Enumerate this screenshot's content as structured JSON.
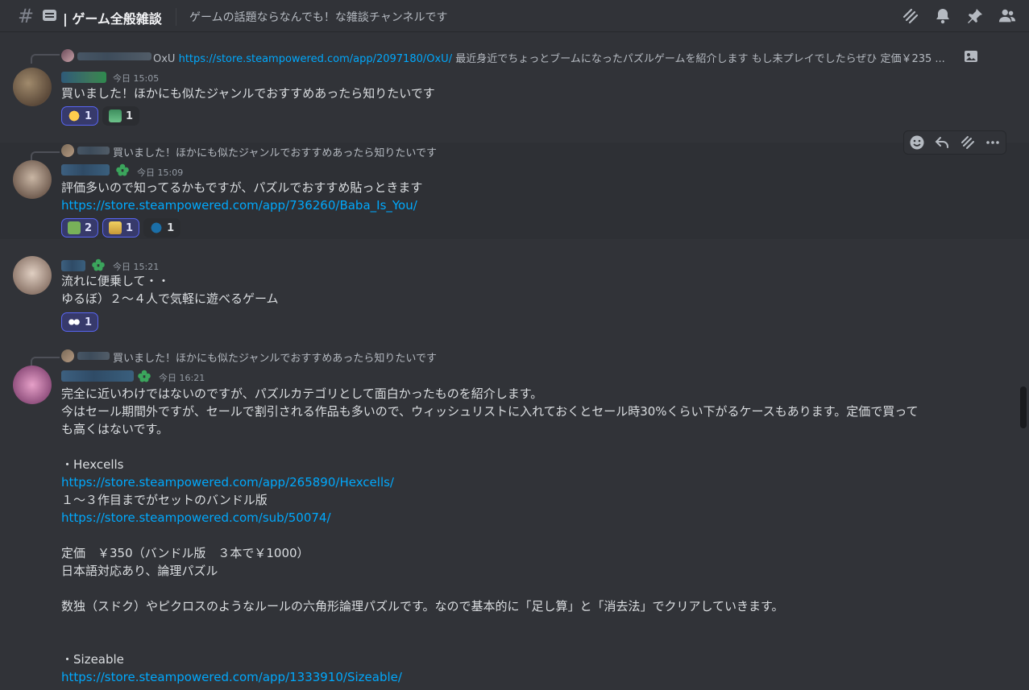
{
  "header": {
    "channel_name": "| ゲーム全般雑談",
    "topic": "ゲームの話題ならなんでも！な雑談チャンネルです"
  },
  "messages": [
    {
      "reply_preview": "OxU",
      "reply_link": "https://store.steampowered.com/app/2097180/OxU/",
      "reply_text": "最近身近でちょっとブームになったパズルゲームを紹介します もし未プレイでしたらぜひ 定価￥235 ...",
      "timestamp": "今日 15:05",
      "lines": [
        "買いました！ほかにも似たジャンルでおすすめあったら知りたいです"
      ],
      "reactions": [
        {
          "emoji": "star-struck-icon",
          "count": "1",
          "me": true
        },
        {
          "emoji": "money-icon",
          "count": "1",
          "me": false
        }
      ]
    },
    {
      "reply_text": "買いました！ほかにも似たジャンルでおすすめあったら知りたいです",
      "timestamp": "今日 15:09",
      "lines": [
        "評価多いので知ってるかもですが、パズルでおすすめ貼っときます"
      ],
      "link": "https://store.steampowered.com/app/736260/Baba_Is_You/",
      "reactions": [
        {
          "emoji": "puzzle-icon",
          "count": "2",
          "me": true
        },
        {
          "emoji": "pixel-face-icon",
          "count": "1",
          "me": true
        },
        {
          "emoji": "steam-icon",
          "count": "1",
          "me": false
        }
      ]
    },
    {
      "timestamp": "今日 15:21",
      "lines": [
        "流れに便乗して・・",
        "ゆるぼ）２～４人で気軽に遊べるゲーム"
      ],
      "reactions": [
        {
          "emoji": "eyes-icon",
          "count": "1",
          "me": true
        }
      ]
    },
    {
      "reply_text": "買いました！ほかにも似たジャンルでおすすめあったら知りたいです",
      "timestamp": "今日 16:21",
      "body": [
        {
          "t": "text",
          "v": "完全に近いわけではないのですが、パズルカテゴリとして面白かったものを紹介します。"
        },
        {
          "t": "text",
          "v": "今はセール期間外ですが、セールで割引される作品も多いので、ウィッシュリストに入れておくとセール時30%くらい下がるケースもあります。定価で買って"
        },
        {
          "t": "text",
          "v": "も高くはないです。"
        },
        {
          "t": "text",
          "v": ""
        },
        {
          "t": "text",
          "v": "・Hexcells"
        },
        {
          "t": "link",
          "v": "https://store.steampowered.com/app/265890/Hexcells/"
        },
        {
          "t": "text",
          "v": "１～３作目までがセットのバンドル版"
        },
        {
          "t": "link",
          "v": "https://store.steampowered.com/sub/50074/"
        },
        {
          "t": "text",
          "v": ""
        },
        {
          "t": "text",
          "v": "定価　￥350（バンドル版　３本で￥1000）"
        },
        {
          "t": "text",
          "v": "日本語対応あり、論理パズル"
        },
        {
          "t": "text",
          "v": ""
        },
        {
          "t": "text",
          "v": "数独（スドク）やピクロスのようなルールの六角形論理パズルです。なので基本的に「足し算」と「消去法」でクリアしていきます。"
        },
        {
          "t": "text",
          "v": ""
        },
        {
          "t": "text",
          "v": ""
        },
        {
          "t": "text",
          "v": "・Sizeable"
        },
        {
          "t": "link",
          "v": "https://store.steampowered.com/app/1333910/Sizeable/"
        }
      ]
    }
  ]
}
